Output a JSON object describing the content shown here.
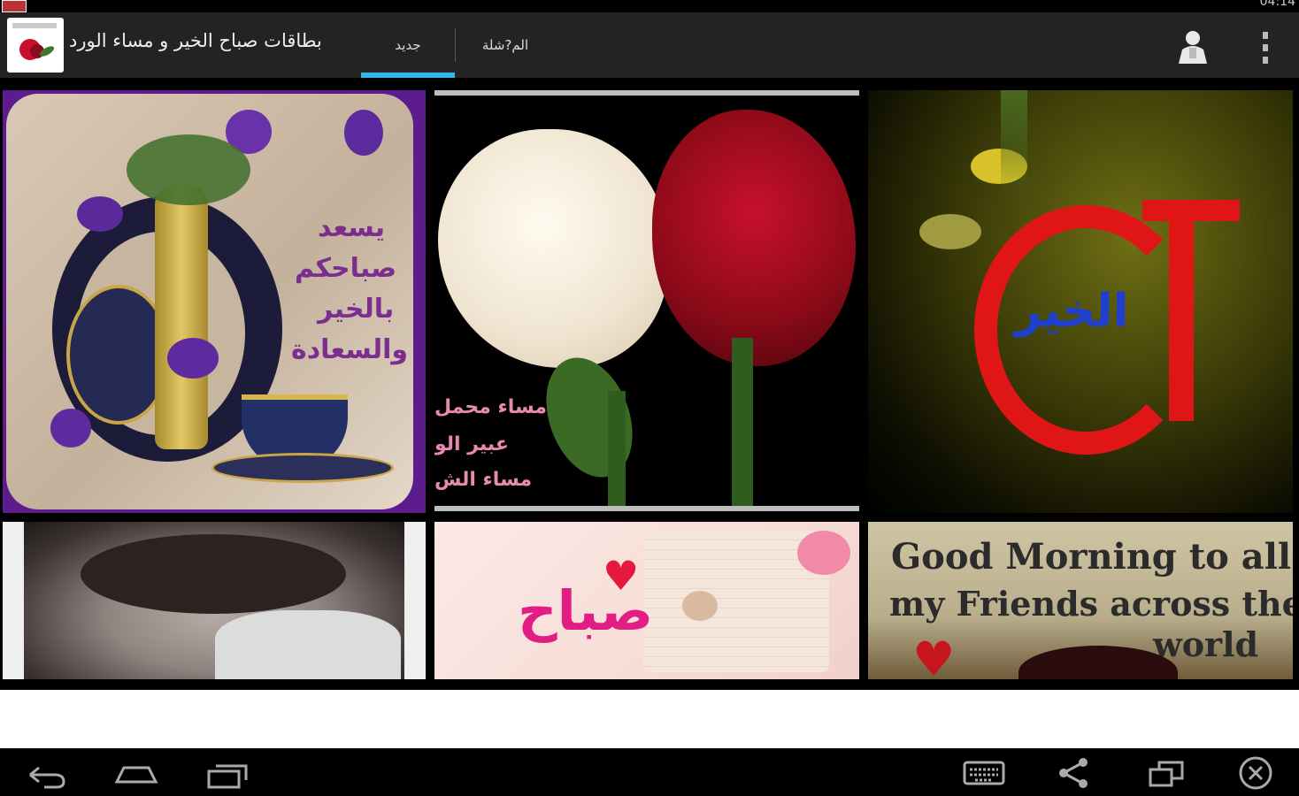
{
  "status_bar": {
    "time": "04:14"
  },
  "action_bar": {
    "app_title": "بطاقات صباح الخير و مساء الورد",
    "tabs": [
      {
        "label": "جديد",
        "active": true
      },
      {
        "label": "الم?شلة",
        "active": false
      }
    ],
    "accent_color": "#33b5e5",
    "icons": [
      "app-logo-icon",
      "person-icon",
      "overflow-menu-icon"
    ]
  },
  "cards": [
    {
      "lines": [
        "يسعد",
        "صباحكم",
        "بالخير",
        "والسعادة"
      ]
    },
    {
      "lines": [
        "مساء محمل",
        "عبير الو",
        "مساء الش"
      ]
    },
    {
      "lines": [
        "الخير"
      ]
    },
    {
      "lines": []
    },
    {
      "lines": [
        "صباح"
      ]
    },
    {
      "lines": [
        "Good Morning to all",
        "my Friends across the",
        "world"
      ]
    }
  ],
  "nav_bar": {
    "icons": [
      "back-icon",
      "home-icon",
      "recent-apps-icon",
      "keyboard-icon",
      "share-icon",
      "window-icon",
      "close-icon"
    ]
  }
}
